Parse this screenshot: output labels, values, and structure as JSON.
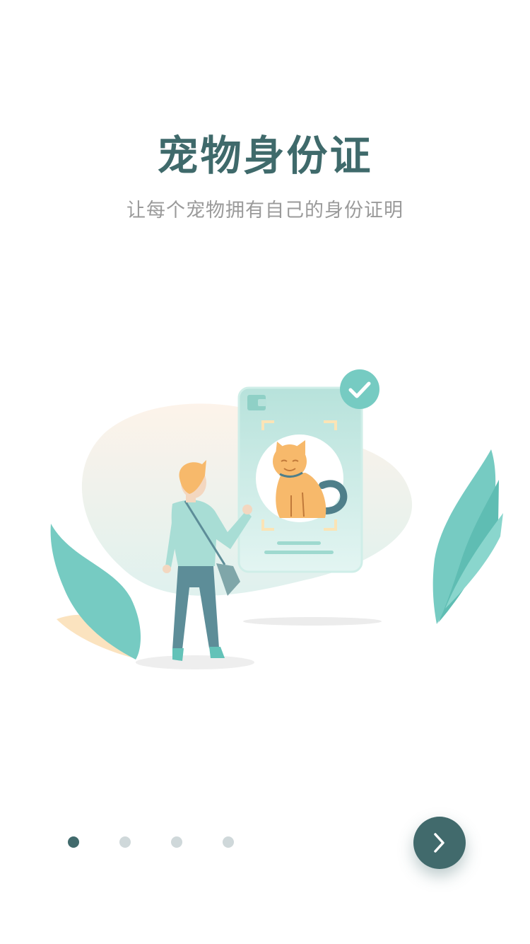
{
  "intro": {
    "title": "宠物身份证",
    "subtitle": "让每个宠物拥有自己的身份证明"
  },
  "illustration": {
    "subject": "person-verifying-pet-id-card",
    "icons": [
      "check-icon",
      "cat-icon",
      "leaf-icon",
      "person-icon"
    ],
    "colors": {
      "teal": "#76cbc2",
      "dark_teal": "#416a6c",
      "cat": "#f7b96b",
      "card": "#bfe6df"
    }
  },
  "pager": {
    "total": 4,
    "current": 1
  },
  "next_button": {
    "icon": "chevron-right-icon",
    "color": "#416a6c"
  }
}
